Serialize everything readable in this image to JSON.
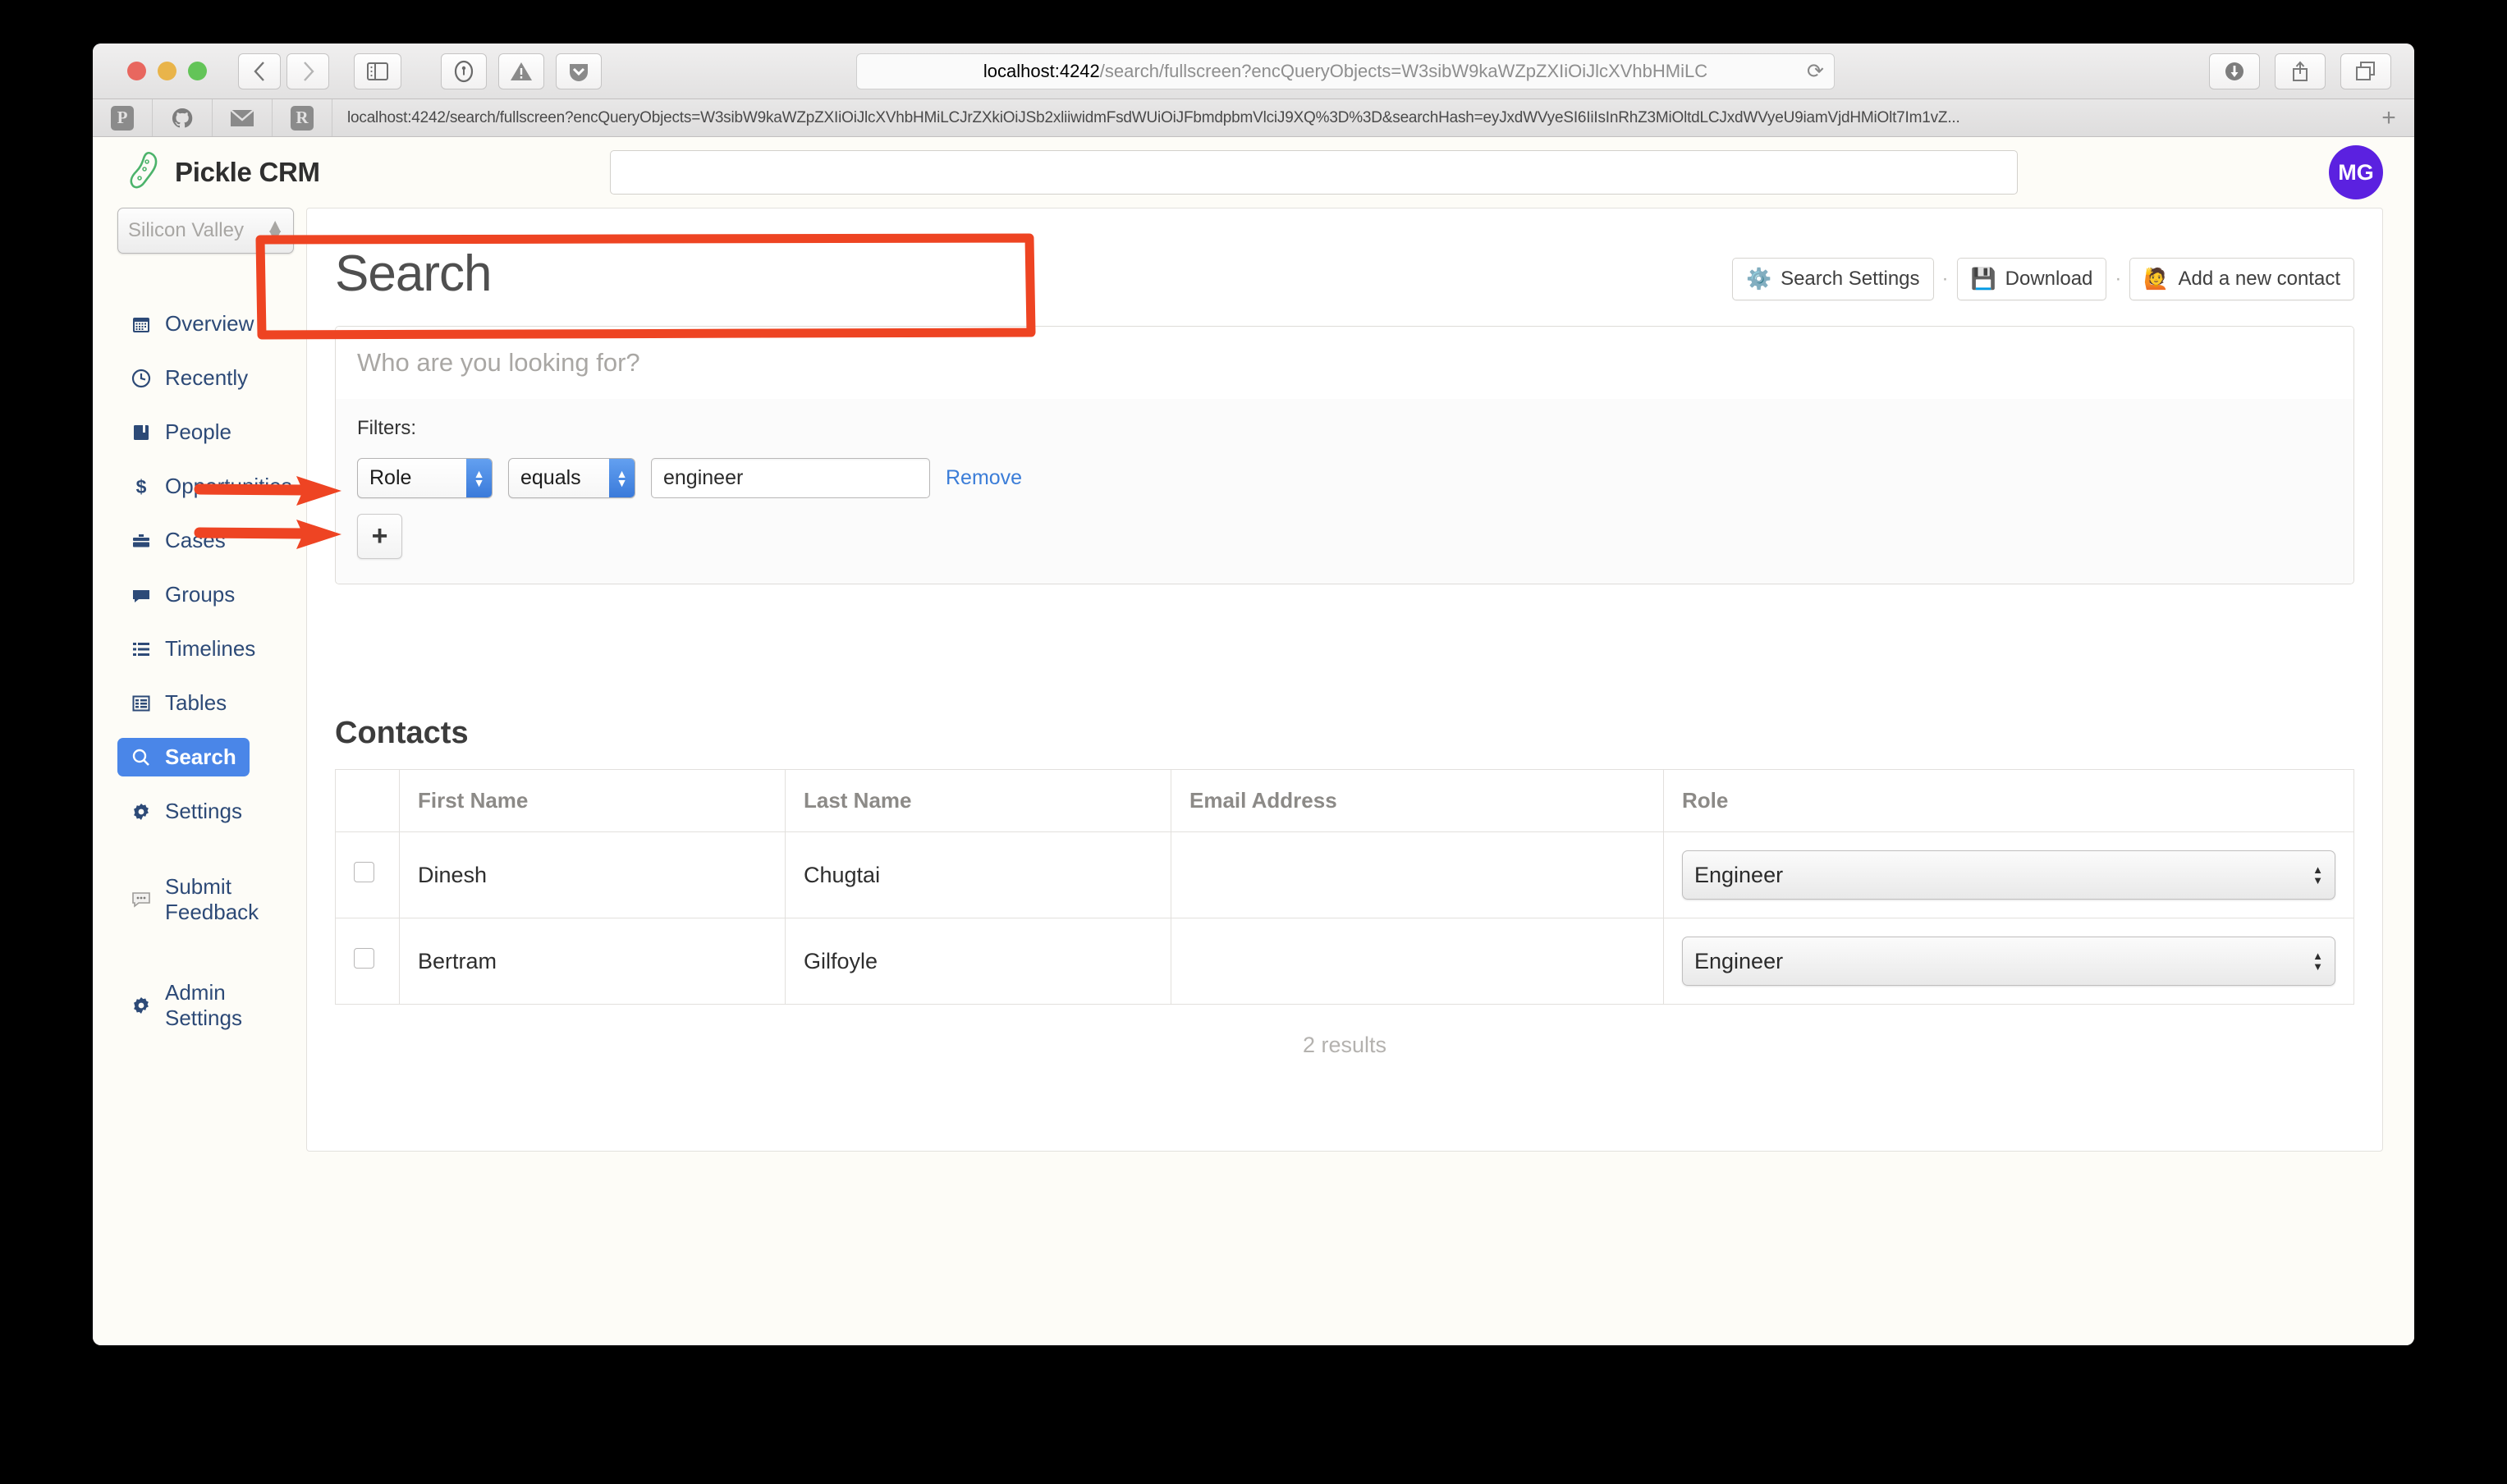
{
  "browser": {
    "url_display": {
      "host": "localhost:4242",
      "path": "/search/fullscreen?encQueryObjects=W3sibW9kaWZpZXIiOiJlcXVhbHMiLC"
    },
    "bookmark_url": "localhost:4242/search/fullscreen?encQueryObjects=W3sibW9kaWZpZXIiOiJlcXVhbHMiLCJrZXkiOiJSb2xliiwidmFsdWUiOiJFbmdpbmVlciJ9XQ%3D%3D&searchHash=eyJxdWVyeSI6IiIsInRhZ3MiOltdLCJxdWVyeU9iamVjdHMiOlt7Im1vZ...",
    "bookmark_icons": [
      "P",
      "github-icon",
      "mail-icon",
      "R"
    ],
    "nav_back": "‹",
    "nav_forward": "›",
    "sidebar_toggle": "sidebar-icon",
    "reload": "⟳",
    "new_tab": "+",
    "right_icons": [
      "downloads-icon",
      "share-icon",
      "tabs-icon"
    ],
    "ext_icons": [
      "1password-icon",
      "warning-icon",
      "pocket-icon"
    ]
  },
  "app": {
    "brand": {
      "logo": "pickle-icon",
      "name": "Pickle CRM"
    },
    "header_search_value": "",
    "avatar_initials": "MG"
  },
  "sidebar": {
    "org_select": {
      "value": "Silicon Valley"
    },
    "items": [
      {
        "label": "Overview",
        "icon": "calendar-icon",
        "active": false
      },
      {
        "label": "Recently",
        "icon": "clock-icon",
        "active": false
      },
      {
        "label": "People",
        "icon": "book-icon",
        "active": false
      },
      {
        "label": "Opportunities",
        "icon": "dollar-icon",
        "active": false
      },
      {
        "label": "Cases",
        "icon": "briefcase-icon",
        "active": false
      },
      {
        "label": "Groups",
        "icon": "comment-icon",
        "active": false
      },
      {
        "label": "Timelines",
        "icon": "list-icon",
        "active": false
      },
      {
        "label": "Tables",
        "icon": "table-icon",
        "active": false
      },
      {
        "label": "Search",
        "icon": "search-icon",
        "active": true
      },
      {
        "label": "Settings",
        "icon": "gear-icon",
        "active": false
      }
    ],
    "feedback": {
      "label": "Submit Feedback",
      "icon": "speech-bubble-icon"
    },
    "admin": {
      "label": "Admin Settings",
      "icon": "gear-icon"
    }
  },
  "main": {
    "page_title": "Search",
    "actions": [
      {
        "label": "Search Settings",
        "emoji": "⚙️"
      },
      {
        "label": "Download",
        "emoji": "💾"
      },
      {
        "label": "Add a new contact",
        "emoji": "🙋"
      }
    ],
    "action_separator": "·",
    "search_placeholder": "Who are you looking for?",
    "search_value": "",
    "filters": {
      "label": "Filters:",
      "rows": [
        {
          "field": "Role",
          "operator": "equals",
          "value": "engineer",
          "remove_label": "Remove"
        }
      ],
      "add_label": "+"
    },
    "results": {
      "title": "Contacts",
      "columns": [
        "",
        "First Name",
        "Last Name",
        "Email Address",
        "Role"
      ],
      "rows": [
        {
          "checked": false,
          "first_name": "Dinesh",
          "last_name": "Chugtai",
          "email": "",
          "role": "Engineer"
        },
        {
          "checked": false,
          "first_name": "Bertram",
          "last_name": "Gilfoyle",
          "email": "",
          "role": "Engineer"
        }
      ],
      "count_label": "2 results"
    }
  },
  "annotations": {
    "highlight_color": "#ee4423",
    "box_target": "filters-section",
    "arrows": [
      "row-dinesh",
      "row-bertram"
    ]
  }
}
